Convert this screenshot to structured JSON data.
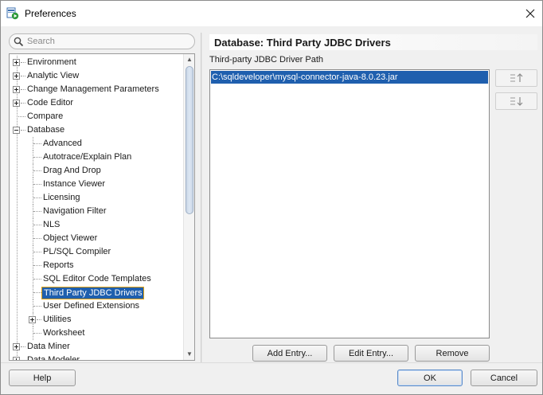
{
  "window": {
    "title": "Preferences"
  },
  "search": {
    "placeholder": "Search",
    "value": ""
  },
  "tree": {
    "items": [
      {
        "label": "Environment",
        "level": 0,
        "expander": "plus"
      },
      {
        "label": "Analytic View",
        "level": 0,
        "expander": "plus"
      },
      {
        "label": "Change Management Parameters",
        "level": 0,
        "expander": "plus"
      },
      {
        "label": "Code Editor",
        "level": 0,
        "expander": "plus"
      },
      {
        "label": "Compare",
        "level": 0,
        "expander": "none"
      },
      {
        "label": "Database",
        "level": 0,
        "expander": "minus"
      },
      {
        "label": "Advanced",
        "level": 1,
        "expander": "none"
      },
      {
        "label": "Autotrace/Explain Plan",
        "level": 1,
        "expander": "none"
      },
      {
        "label": "Drag And Drop",
        "level": 1,
        "expander": "none"
      },
      {
        "label": "Instance Viewer",
        "level": 1,
        "expander": "none"
      },
      {
        "label": "Licensing",
        "level": 1,
        "expander": "none"
      },
      {
        "label": "Navigation Filter",
        "level": 1,
        "expander": "none"
      },
      {
        "label": "NLS",
        "level": 1,
        "expander": "none"
      },
      {
        "label": "Object Viewer",
        "level": 1,
        "expander": "none"
      },
      {
        "label": "PL/SQL Compiler",
        "level": 1,
        "expander": "none"
      },
      {
        "label": "Reports",
        "level": 1,
        "expander": "none"
      },
      {
        "label": "SQL Editor Code Templates",
        "level": 1,
        "expander": "none"
      },
      {
        "label": "Third Party JDBC Drivers",
        "level": 1,
        "expander": "none",
        "selected": true
      },
      {
        "label": "User Defined Extensions",
        "level": 1,
        "expander": "none"
      },
      {
        "label": "Utilities",
        "level": 1,
        "expander": "plus"
      },
      {
        "label": "Worksheet",
        "level": 1,
        "expander": "none"
      },
      {
        "label": "Data Miner",
        "level": 0,
        "expander": "plus"
      },
      {
        "label": "Data Modeler",
        "level": 0,
        "expander": "plus"
      }
    ]
  },
  "panel": {
    "title": "Database: Third Party JDBC Drivers",
    "path_label": "Third-party JDBC Driver Path",
    "paths": [
      "C:\\sqldeveloper\\mysql-connector-java-8.0.23.jar"
    ]
  },
  "buttons": {
    "add_entry": "Add Entry...",
    "edit_entry": "Edit Entry...",
    "remove": "Remove",
    "help": "Help",
    "ok": "OK",
    "cancel": "Cancel"
  }
}
